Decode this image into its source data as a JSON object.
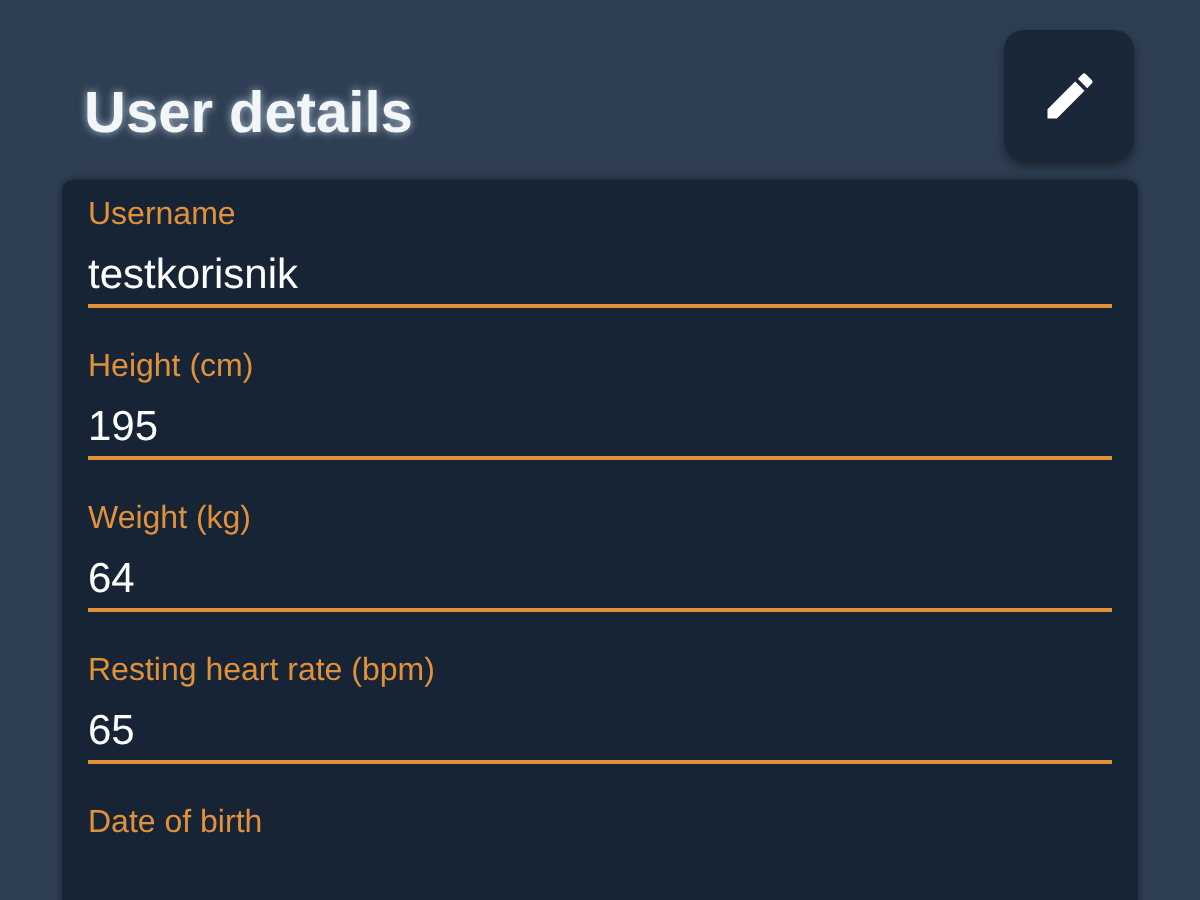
{
  "title": "User details",
  "fields": [
    {
      "label": "Username",
      "value": "testkorisnik"
    },
    {
      "label": "Height (cm)",
      "value": "195"
    },
    {
      "label": "Weight (kg)",
      "value": "64"
    },
    {
      "label": "Resting heart rate (bpm)",
      "value": "65"
    },
    {
      "label": "Date of birth"
    }
  ]
}
